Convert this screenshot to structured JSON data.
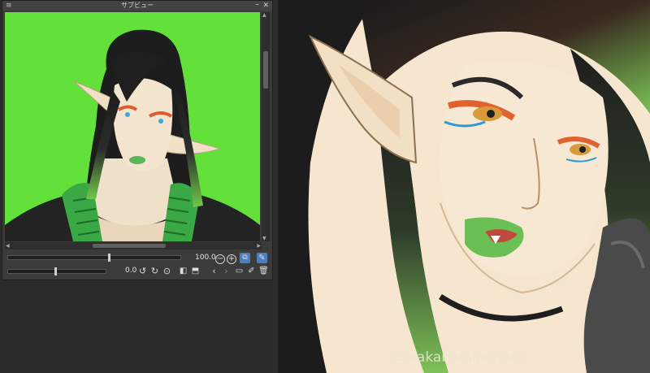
{
  "subview": {
    "title": "サブビュー",
    "menu_icon": "≡",
    "minimize_icon": "–",
    "close_icon": "✕"
  },
  "navigator": {
    "zoom_value": "100.0",
    "rotation_value": "0.0"
  },
  "canvas": {
    "watermark": "@wakabaminohara"
  },
  "colors": {
    "preview_bg": "#64e03b",
    "panel_bg": "#3b3b3b",
    "accent": "#4a7fc1"
  },
  "icons": {
    "zoom_out": "zoom-out-icon",
    "zoom_in": "zoom-in-icon",
    "fit": "fit-to-window-icon",
    "eyedropper": "eyedropper-icon",
    "rotate_left": "rotate-left-icon",
    "rotate_right": "rotate-right-icon",
    "reset": "reset-rotation-icon",
    "flip_h": "flip-horizontal-icon",
    "flip_v": "flip-vertical-icon",
    "prev": "previous-icon",
    "next": "next-icon",
    "open": "open-folder-icon",
    "edit": "edit-icon",
    "delete": "trash-icon"
  }
}
